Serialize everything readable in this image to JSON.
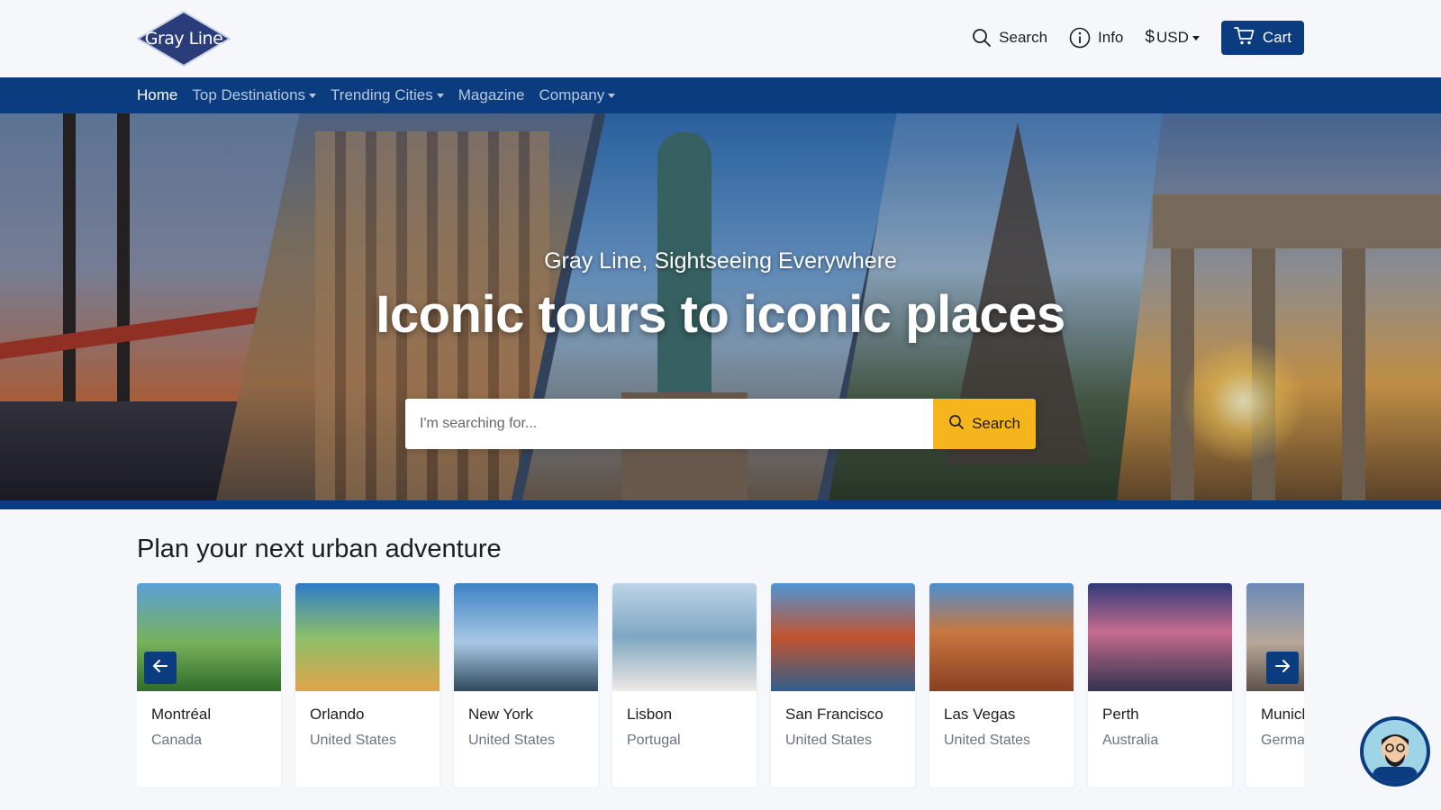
{
  "brand": {
    "logo_text": "Gray Line",
    "primary_color": "#0b3c7f",
    "accent_color": "#f7b51d"
  },
  "header": {
    "search_label": "Search",
    "info_label": "Info",
    "currency_symbol": "$",
    "currency_label": "USD",
    "cart_label": "Cart"
  },
  "nav": {
    "items": [
      {
        "label": "Home",
        "active": true,
        "has_dropdown": false
      },
      {
        "label": "Top Destinations",
        "active": false,
        "has_dropdown": true
      },
      {
        "label": "Trending Cities",
        "active": false,
        "has_dropdown": true
      },
      {
        "label": "Magazine",
        "active": false,
        "has_dropdown": false
      },
      {
        "label": "Company",
        "active": false,
        "has_dropdown": true
      }
    ]
  },
  "hero": {
    "subtitle": "Gray Line, Sightseeing Everywhere",
    "title": "Iconic tours to iconic places",
    "search_placeholder": "I'm searching for...",
    "search_button": "Search"
  },
  "section": {
    "title": "Plan your next urban adventure"
  },
  "cards": [
    {
      "city": "Montréal",
      "country": "Canada"
    },
    {
      "city": "Orlando",
      "country": "United States"
    },
    {
      "city": "New York",
      "country": "United States"
    },
    {
      "city": "Lisbon",
      "country": "Portugal"
    },
    {
      "city": "San Francisco",
      "country": "United States"
    },
    {
      "city": "Las Vegas",
      "country": "United States"
    },
    {
      "city": "Perth",
      "country": "Australia"
    },
    {
      "city": "Munich",
      "country": "Germany"
    }
  ],
  "icons": {
    "search": "search-icon",
    "info": "info-icon",
    "cart": "cart-icon",
    "prev": "arrow-left-icon",
    "next": "arrow-right-icon",
    "chat": "chat-avatar-icon"
  }
}
